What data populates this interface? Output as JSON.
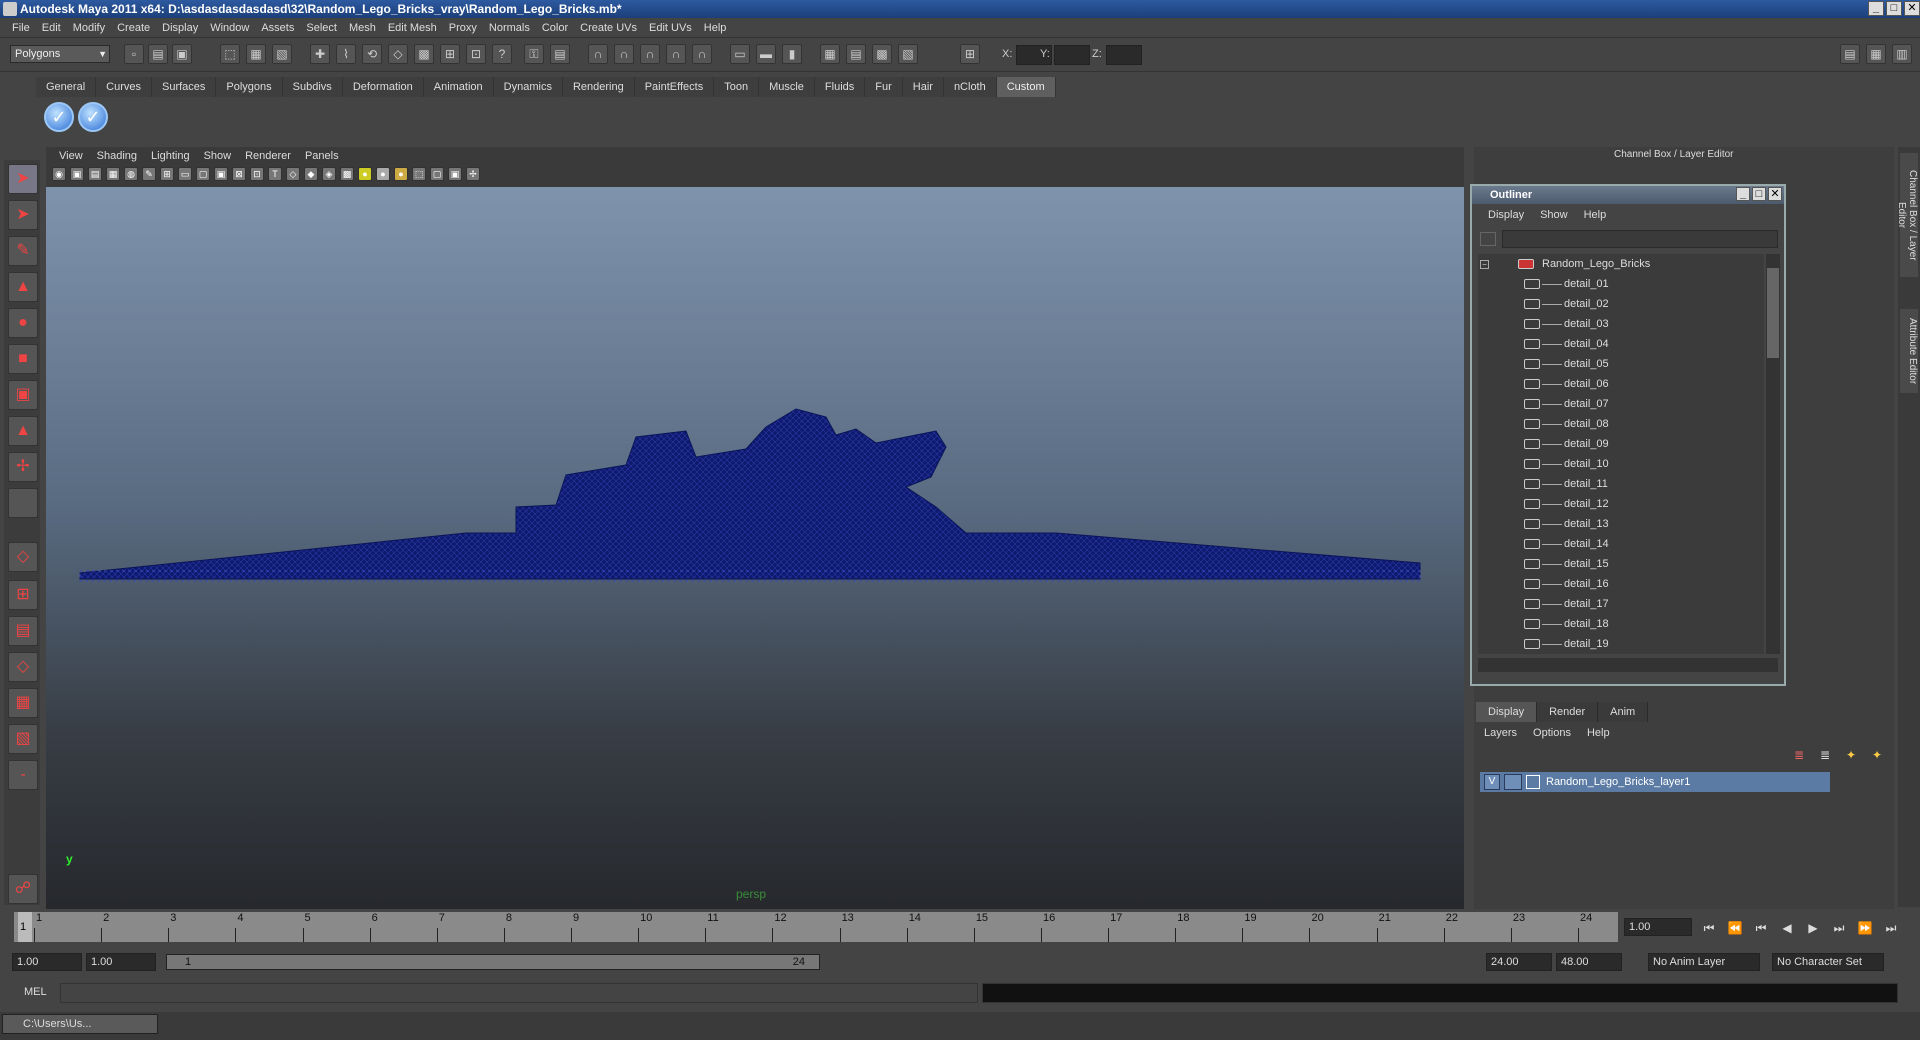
{
  "window": {
    "title": "Autodesk Maya 2011 x64: D:\\asdasdasdasdasd\\32\\Random_Lego_Bricks_vray\\Random_Lego_Bricks.mb*"
  },
  "menubar": [
    "File",
    "Edit",
    "Modify",
    "Create",
    "Display",
    "Window",
    "Assets",
    "Select",
    "Mesh",
    "Edit Mesh",
    "Proxy",
    "Normals",
    "Color",
    "Create UVs",
    "Edit UVs",
    "Help"
  ],
  "status": {
    "mode": "Polygons",
    "x_label": "X:",
    "y_label": "Y:",
    "z_label": "Z:"
  },
  "shelf": {
    "tabs": [
      "General",
      "Curves",
      "Surfaces",
      "Polygons",
      "Subdivs",
      "Deformation",
      "Animation",
      "Dynamics",
      "Rendering",
      "PaintEffects",
      "Toon",
      "Muscle",
      "Fluids",
      "Fur",
      "Hair",
      "nCloth",
      "Custom"
    ],
    "active_tab": "Custom"
  },
  "viewport": {
    "menu": [
      "View",
      "Shading",
      "Lighting",
      "Show",
      "Renderer",
      "Panels"
    ],
    "camera_label": "persp",
    "axis_y": "y",
    "wire_color": "#0e1a6e"
  },
  "right_panel": {
    "title": "Channel Box / Layer Editor",
    "side_tabs": [
      "Channel Box / Layer Editor",
      "Attribute Editor"
    ]
  },
  "outliner": {
    "title": "Outliner",
    "menu": [
      "Display",
      "Show",
      "Help"
    ],
    "root": "Random_Lego_Bricks",
    "items": [
      "detail_01",
      "detail_02",
      "detail_03",
      "detail_04",
      "detail_05",
      "detail_06",
      "detail_07",
      "detail_08",
      "detail_09",
      "detail_10",
      "detail_11",
      "detail_12",
      "detail_13",
      "detail_14",
      "detail_15",
      "detail_16",
      "detail_17",
      "detail_18",
      "detail_19"
    ]
  },
  "layer_editor": {
    "tabs": [
      "Display",
      "Render",
      "Anim"
    ],
    "menu": [
      "Layers",
      "Options",
      "Help"
    ],
    "layer_visibility": "V",
    "layer_name": "Random_Lego_Bricks_layer1"
  },
  "timeline": {
    "ticks": [
      "1",
      "2",
      "3",
      "4",
      "5",
      "6",
      "7",
      "8",
      "9",
      "10",
      "11",
      "12",
      "13",
      "14",
      "15",
      "16",
      "17",
      "18",
      "19",
      "20",
      "21",
      "22",
      "23",
      "24"
    ],
    "current_frame": "1",
    "current_time": "1.00"
  },
  "range": {
    "start_time": "1.00",
    "playback_start": "1.00",
    "slider_start": "1",
    "slider_end": "24",
    "playback_end": "24.00",
    "end_time": "48.00",
    "anim_layer": "No Anim Layer",
    "character_set": "No Character Set"
  },
  "command_line": {
    "label": "MEL"
  },
  "taskbar": {
    "window_label": "C:\\Users\\Us..."
  }
}
